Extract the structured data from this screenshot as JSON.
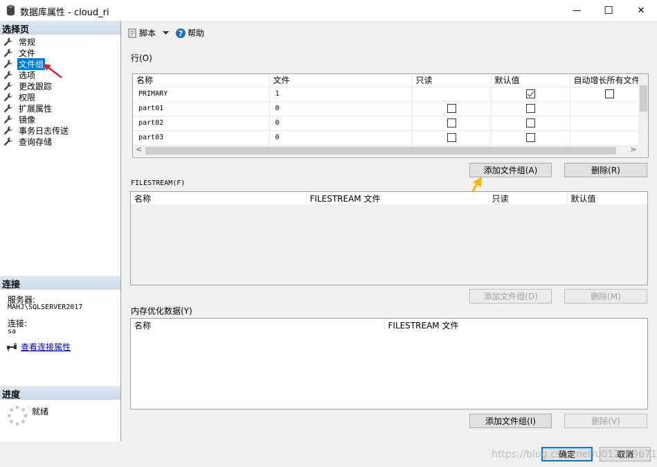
{
  "window": {
    "title": "数据库属性 - cloud_ri",
    "minimize_glyph": "—",
    "maximize_glyph": "☐",
    "close_glyph": "✕"
  },
  "left": {
    "select_page_header": "选择页",
    "nav_items": [
      {
        "label": "常规"
      },
      {
        "label": "文件"
      },
      {
        "label": "文件组"
      },
      {
        "label": "选项"
      },
      {
        "label": "更改跟踪"
      },
      {
        "label": "权限"
      },
      {
        "label": "扩展属性"
      },
      {
        "label": "镜像"
      },
      {
        "label": "事务日志传送"
      },
      {
        "label": "查询存储"
      }
    ],
    "connection_header": "连接",
    "server_label": "服务器:",
    "server_value": "MAHJ\\SQLSERVER2017",
    "conn_label": "连接:",
    "conn_value": "sa",
    "view_conn_props": "查看连接属性",
    "progress_header": "进度",
    "progress_status": "就绪"
  },
  "toolbar": {
    "script_label": "脚本",
    "help_label": "帮助"
  },
  "rows_section": {
    "label": "行(O)",
    "columns": [
      "名称",
      "文件",
      "只读",
      "默认值",
      "自动增长所有文件"
    ],
    "rows": [
      {
        "name": "PRIMARY",
        "files": "1",
        "readonly": null,
        "default": true,
        "autogrow": false
      },
      {
        "name": "part01",
        "files": "0",
        "readonly": false,
        "default": false,
        "autogrow": null
      },
      {
        "name": "part02",
        "files": "0",
        "readonly": false,
        "default": false,
        "autogrow": null
      },
      {
        "name": "part03",
        "files": "0",
        "readonly": false,
        "default": false,
        "autogrow": null
      }
    ],
    "add_button": "添加文件组(A)",
    "remove_button": "删除(R)"
  },
  "filestream_section": {
    "label": "FILESTREAM(F)",
    "columns": [
      "名称",
      "FILESTREAM 文件",
      "只读",
      "默认值"
    ],
    "add_button": "添加文件组(D)",
    "remove_button": "删除(M)"
  },
  "memory_section": {
    "label": "内存优化数据(Y)",
    "columns": [
      "名称",
      "FILESTREAM 文件"
    ],
    "add_button": "添加文件组(I)",
    "remove_button": "删除(V)"
  },
  "footer": {
    "ok_button": "确定",
    "cancel_button": "取消",
    "watermark": "https://blog.csdn.net/u012359671"
  },
  "colors": {
    "selection": "#0078d7",
    "section_header": "#cad9ea",
    "red_arrow": "#e02020",
    "yellow_arrow": "#f5b800"
  }
}
